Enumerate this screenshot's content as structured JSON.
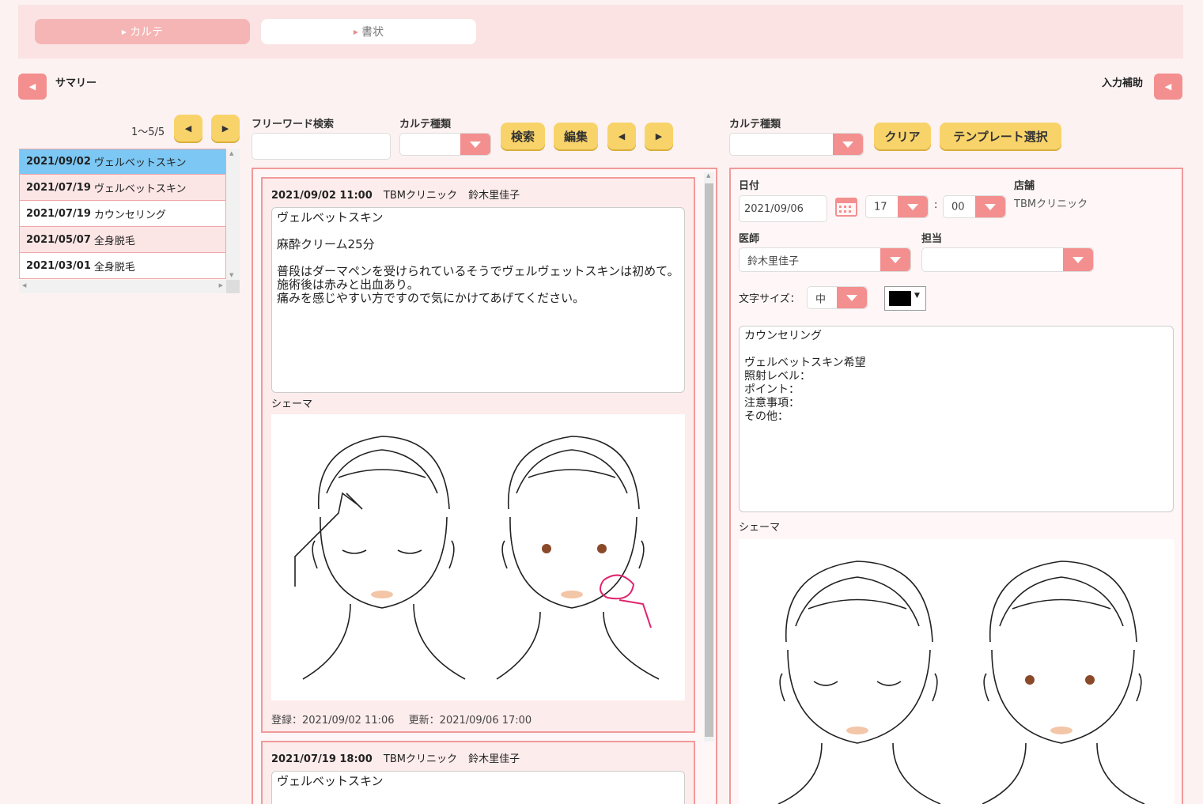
{
  "tabs": [
    {
      "label": "カルテ"
    },
    {
      "label": "書状"
    }
  ],
  "left": {
    "title": "サマリー",
    "count": "1〜5/5",
    "items": [
      {
        "date": "2021/09/02",
        "name": "ヴェルベットスキン"
      },
      {
        "date": "2021/07/19",
        "name": "ヴェルベットスキン"
      },
      {
        "date": "2021/07/19",
        "name": "カウンセリング"
      },
      {
        "date": "2021/05/07",
        "name": "全身脱毛"
      },
      {
        "date": "2021/03/01",
        "name": "全身脱毛"
      }
    ]
  },
  "search": {
    "freeword_label": "フリーワード検索",
    "freeword_value": "",
    "type_label": "カルテ種類",
    "search_btn": "検索",
    "edit_btn": "編集"
  },
  "records": [
    {
      "datetime": "2021/09/02 11:00",
      "clinic": "TBMクリニック",
      "doctor": "鈴木里佳子",
      "text": "ヴェルベットスキン\n\n麻酔クリーム25分\n\n普段はダーマペンを受けられているそうでヴェルヴェットスキンは初めて。\n施術後は赤みと出血あり。\n痛みを感じやすい方ですので気にかけてあげてください。",
      "schema_label": "シェーマ",
      "registered": "登録：2021/09/02 11:06",
      "updated": "更新：2021/09/06 17:00"
    },
    {
      "datetime": "2021/07/19 18:00",
      "clinic": "TBMクリニック",
      "doctor": "鈴木里佳子",
      "text": "ヴェルベットスキン"
    }
  ],
  "right": {
    "assist_label": "入力補助",
    "type_label": "カルテ種類",
    "clear_btn": "クリア",
    "template_btn": "テンプレート選択",
    "date_label": "日付",
    "date_value": "2021/09/06",
    "hour": "17",
    "minute": "00",
    "colon": ":",
    "shop_label": "店舗",
    "shop_value": "TBMクリニック",
    "doctor_label": "医師",
    "doctor_value": "鈴木里佳子",
    "staff_label": "担当",
    "fontsize_label": "文字サイズ：",
    "fontsize_value": "中",
    "text": "カウンセリング\n\nヴェルベットスキン希望\n照射レベル：\nポイント：\n注意事項：\nその他：",
    "schema_label": "シェーマ"
  },
  "colors": {
    "accent": "#f48f8f",
    "button": "#f8d36a",
    "selected": "#7cc7f3"
  }
}
